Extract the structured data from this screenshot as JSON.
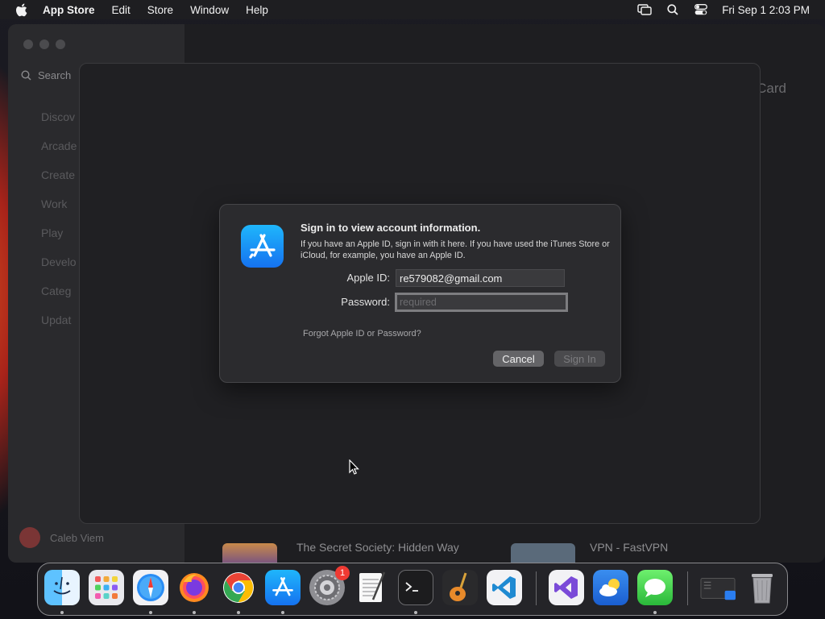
{
  "menubar": {
    "app_name": "App Store",
    "menus": [
      "Edit",
      "Store",
      "Window",
      "Help"
    ],
    "clock": "Fri Sep 1  2:03 PM",
    "status_icons": [
      "screen-mirroring-icon",
      "spotlight-search-icon",
      "control-center-icon"
    ]
  },
  "sidebar": {
    "search_placeholder": "Search",
    "items": [
      "Discov",
      "Arcade",
      "Create",
      "Work",
      "Play",
      "Develo",
      "Categ",
      "Updat"
    ],
    "user_name": "Caleb Viem"
  },
  "main": {
    "top_right_text": "Card",
    "bottom_items": [
      "The Secret Society: Hidden Way",
      "VPN - FastVPN"
    ]
  },
  "dialog": {
    "title": "Sign in to view account information.",
    "message": "If you have an Apple ID, sign in with it here. If you have used the iTunes Store or iCloud, for example, you have an Apple ID.",
    "apple_id_label": "Apple ID:",
    "apple_id_value": "re579082@gmail.com",
    "password_label": "Password:",
    "password_placeholder": "required",
    "forgot_link": "Forgot Apple ID or Password?",
    "cancel_label": "Cancel",
    "signin_label": "Sign In"
  },
  "dock": {
    "apps": [
      {
        "name": "finder-icon",
        "running": true
      },
      {
        "name": "launchpad-icon",
        "running": false
      },
      {
        "name": "safari-icon",
        "running": true
      },
      {
        "name": "firefox-icon",
        "running": true
      },
      {
        "name": "chrome-icon",
        "running": true
      },
      {
        "name": "app-store-icon",
        "running": true
      },
      {
        "name": "system-settings-icon",
        "running": false,
        "badge": "1"
      },
      {
        "name": "textedit-icon",
        "running": false
      },
      {
        "name": "terminal-icon",
        "running": true
      },
      {
        "name": "garageband-icon",
        "running": false
      },
      {
        "name": "vscode-icon",
        "running": false
      },
      {
        "name": "visual-studio-icon",
        "running": false
      },
      {
        "name": "weather-icon",
        "running": false
      },
      {
        "name": "messages-icon",
        "running": true
      },
      {
        "name": "downloads-folder-icon",
        "running": false
      },
      {
        "name": "trash-icon",
        "running": false
      }
    ]
  },
  "colors": {
    "app_store_blue": "#1a8cf5",
    "badge_red": "#ef3a33"
  }
}
